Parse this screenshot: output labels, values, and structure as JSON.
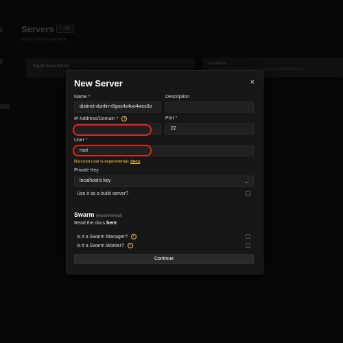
{
  "background": {
    "title": "Servers",
    "add_label": "+ Add",
    "subtitle": "All your servers are here.",
    "card1_name": "Rapid Goes Server",
    "card2_title": "localhost",
    "card2_desc": "This is the server where Coolify is running on. Don't delete this!"
  },
  "modal": {
    "title": "New Server",
    "close_icon": "×",
    "name_label": "Name",
    "name_value": "distinct-dunlin-r8gos4s4oo4wcs0o",
    "description_label": "Description",
    "description_value": "",
    "ip_label": "IP Address/Domain",
    "ip_value": "",
    "port_label": "Port",
    "port_value": "22",
    "user_label": "User",
    "user_value": "root",
    "required_mark": "*",
    "warning_text": "Non-root user is experimental: ",
    "warning_link": "docs",
    "warning_end": ".",
    "private_key_label": "Private Key",
    "private_key_value": "localhost's key",
    "build_server_label": "Use it as a build server?",
    "swarm_title": "Swarm",
    "swarm_tag": "(experimental)",
    "docs_text": "Read the docs ",
    "docs_link": "here",
    "docs_end": ".",
    "swarm_manager_label": "Is it a Swarm Manager?",
    "swarm_worker_label": "Is it a Swarm Worker?",
    "continue_label": "Continue"
  },
  "colors": {
    "accent_warning": "#f5c542",
    "highlight_red": "#e02424"
  }
}
